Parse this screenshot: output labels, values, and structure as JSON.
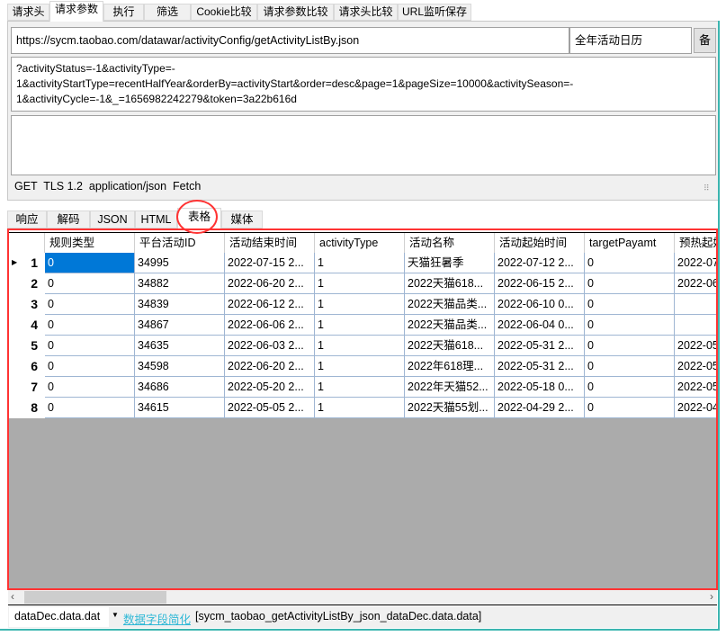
{
  "top_tabs": [
    "请求头",
    "请求参数",
    "执行",
    "筛选",
    "Cookie比较",
    "请求参数比较",
    "请求头比较",
    "URL监听保存"
  ],
  "selected_top_tab": "请求参数",
  "request": {
    "url": "https://sycm.taobao.com/datawar/activityConfig/getActivityListBy.json",
    "name": "全年活动日历",
    "backup_button": "备",
    "query_lines": [
      "?activityStatus=-1&activityType=-",
      "1&activityStartType=recentHalfYear&orderBy=activityStart&order=desc&page=1&pageSize=10000&activitySeason=-",
      "1&activityCycle=-1&_=1656982242279&token=3a22b616d"
    ],
    "body": "",
    "status": "GET  TLS 1.2  application/json  Fetch"
  },
  "bottom_tabs": [
    "响应",
    "解码",
    "JSON",
    "HTML",
    "表格",
    "媒体"
  ],
  "selected_bottom_tab": "表格",
  "table": {
    "columns": [
      "规则类型",
      "平台活动ID",
      "活动结束时间",
      "activityType",
      "活动名称",
      "活动起始时间",
      "targetPayamt",
      "预热起始"
    ],
    "rows": [
      {
        "n": "1",
        "c": [
          "0",
          "34995",
          "2022-07-15 2...",
          "1",
          "天猫狂暑季",
          "2022-07-12 2...",
          "0",
          "2022-07"
        ]
      },
      {
        "n": "2",
        "c": [
          "0",
          "34882",
          "2022-06-20 2...",
          "1",
          "2022天猫618...",
          "2022-06-15 2...",
          "0",
          "2022-06"
        ]
      },
      {
        "n": "3",
        "c": [
          "0",
          "34839",
          "2022-06-12 2...",
          "1",
          "2022天猫品类...",
          "2022-06-10 0...",
          "0",
          ""
        ]
      },
      {
        "n": "4",
        "c": [
          "0",
          "34867",
          "2022-06-06 2...",
          "1",
          "2022天猫品类...",
          "2022-06-04 0...",
          "0",
          ""
        ]
      },
      {
        "n": "5",
        "c": [
          "0",
          "34635",
          "2022-06-03 2...",
          "1",
          "2022天猫618...",
          "2022-05-31 2...",
          "0",
          "2022-05"
        ]
      },
      {
        "n": "6",
        "c": [
          "0",
          "34598",
          "2022-06-20 2...",
          "1",
          "2022年618理...",
          "2022-05-31 2...",
          "0",
          "2022-05"
        ]
      },
      {
        "n": "7",
        "c": [
          "0",
          "34686",
          "2022-05-20 2...",
          "1",
          "2022年天猫52...",
          "2022-05-18 0...",
          "0",
          "2022-05"
        ]
      },
      {
        "n": "8",
        "c": [
          "0",
          "34615",
          "2022-05-05 2...",
          "1",
          "2022天猫55划...",
          "2022-04-29 2...",
          "0",
          "2022-04"
        ]
      }
    ]
  },
  "footer": {
    "path_select": "dataDec.data.dat",
    "simplify_link": "数据字段简化",
    "table_name": "[sycm_taobao_getActivityListBy_json_dataDec.data.data]"
  },
  "colors": {
    "highlight": "#ff3333",
    "selection": "#0078d7",
    "link": "#2fb8d6"
  }
}
